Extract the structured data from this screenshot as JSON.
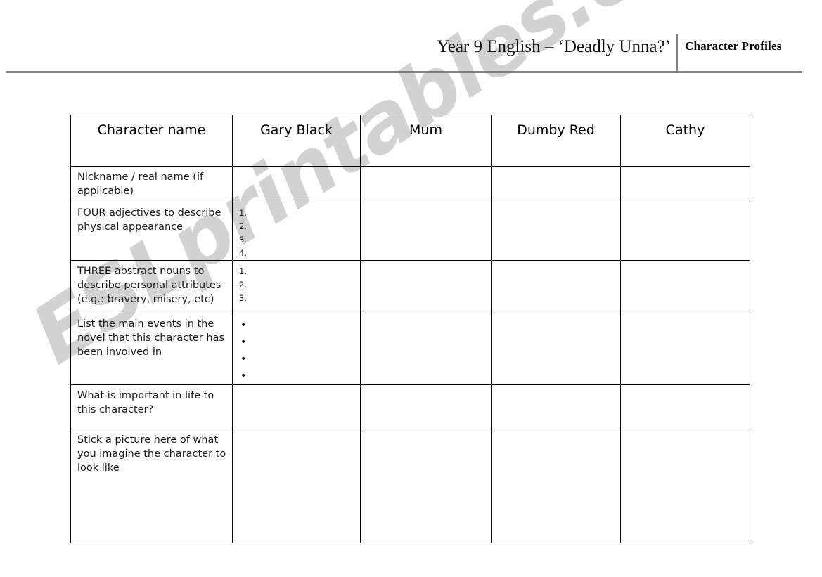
{
  "header": {
    "title": "Year 9 English – ‘Deadly Unna?’",
    "subtitle": "Character Profiles"
  },
  "watermark": {
    "text": "ESLprintables.com",
    "color": "#d2d2d2"
  },
  "table": {
    "columns": [
      {
        "key": "label",
        "header": "Character name"
      },
      {
        "key": "gary",
        "header": "Gary Black"
      },
      {
        "key": "mum",
        "header": "Mum"
      },
      {
        "key": "dumby",
        "header": "Dumby Red"
      },
      {
        "key": "cathy",
        "header": "Cathy"
      }
    ],
    "rows": [
      {
        "label": "Nickname / real name (if applicable)",
        "gary_markers": []
      },
      {
        "label": "FOUR adjectives to describe physical appearance",
        "gary_markers": [
          "1.",
          "2.",
          "3.",
          "4."
        ]
      },
      {
        "label": "THREE abstract nouns to describe personal attributes (e.g.: bravery, misery, etc)",
        "gary_markers": [
          "1.",
          "2.",
          "3."
        ]
      },
      {
        "label": "List the main events in the novel that this character has been involved in",
        "gary_markers": [
          "•",
          "•",
          "•",
          "•"
        ]
      },
      {
        "label": "What is important in life to this character?",
        "gary_markers": []
      },
      {
        "label": "Stick a picture  here of what you imagine the character to look like",
        "gary_markers": []
      }
    ]
  }
}
